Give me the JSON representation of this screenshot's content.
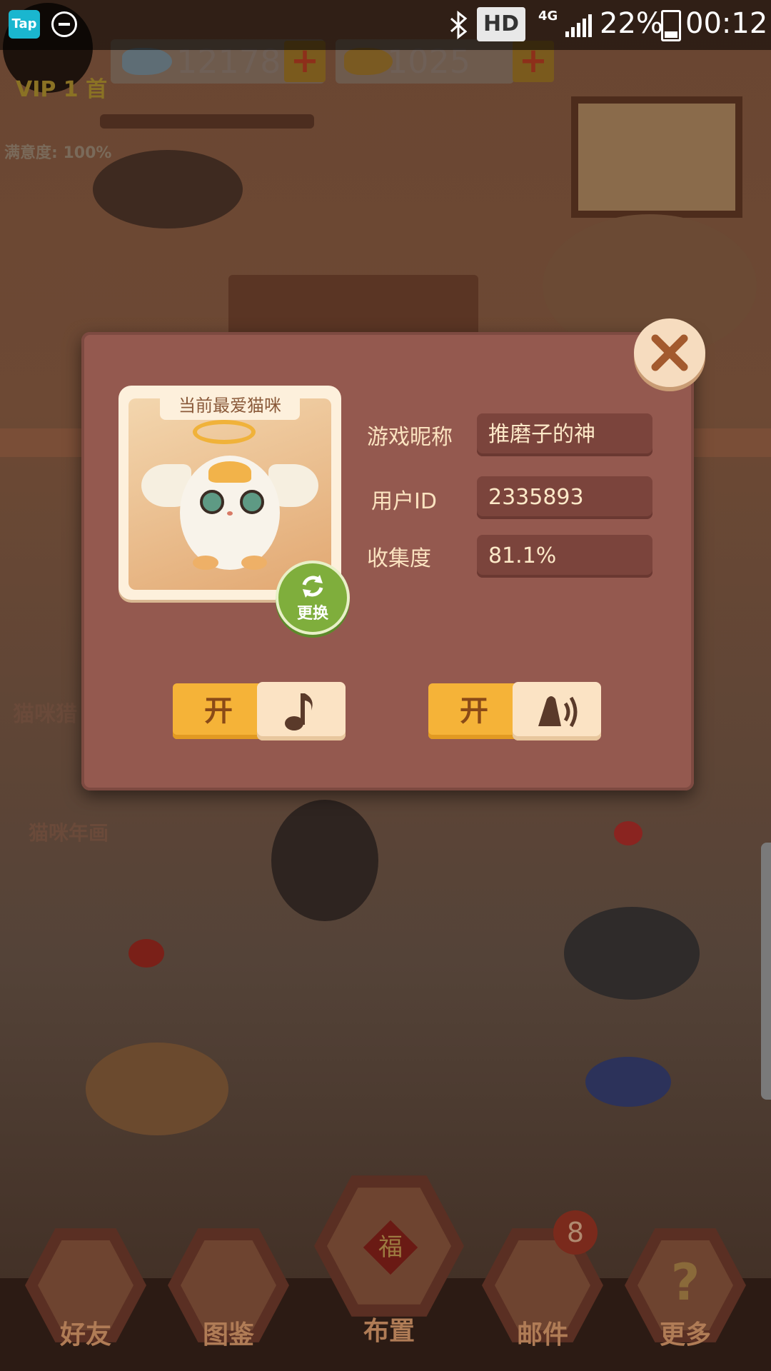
{
  "status_bar": {
    "app_badge": "Tap",
    "network_badge": "HD",
    "network_type": "4G",
    "battery_percent": "22%",
    "time": "00:12"
  },
  "top_hud": {
    "vip_label": "VIP 1",
    "vip_suffix": "首",
    "satisfaction": "满意度: 100%",
    "fish_currency": "12178",
    "gold_fish_currency": "1025",
    "add_symbol": "+"
  },
  "side_menu": {
    "item1": "猫咪猎",
    "item2": "猫咪年画"
  },
  "bottom_nav": [
    {
      "label": "好友"
    },
    {
      "label": "图鉴"
    },
    {
      "label": "布置",
      "sign": "福"
    },
    {
      "label": "邮件",
      "badge": "8"
    },
    {
      "label": "更多",
      "icon_text": "?"
    }
  ],
  "dialog": {
    "favorite_card_title": "当前最爱猫咪",
    "change_button_label": "更换",
    "fields": [
      {
        "label": "游戏昵称",
        "value": "推磨子的神"
      },
      {
        "label": "用户ID",
        "value": "2335893"
      },
      {
        "label": "收集度",
        "value": "81.1%"
      }
    ],
    "music_toggle_label": "开",
    "sound_toggle_label": "开"
  },
  "colors": {
    "dialog_bg": "#94594f",
    "field_bg": "#7b443c",
    "toggle_on": "#f5b338",
    "close_button": "#f6dcbf",
    "change_button": "#7fae3c"
  },
  "icons": [
    "close-icon",
    "music-note-icon",
    "speaker-icon",
    "refresh-icon",
    "bluetooth-icon",
    "signal-icon",
    "battery-icon",
    "dnd-icon",
    "fish-icon",
    "gold-fish-icon"
  ]
}
